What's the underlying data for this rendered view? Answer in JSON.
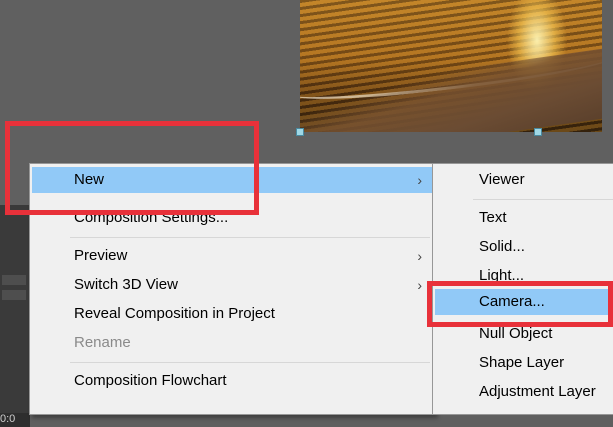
{
  "timeline": {
    "timecode": "0:0"
  },
  "context_menu": {
    "items": [
      {
        "label": "New",
        "arrow": "›",
        "highlight": true
      },
      {
        "label": "Composition Settings..."
      },
      {
        "label": "Preview",
        "arrow": "›"
      },
      {
        "label": "Switch 3D View",
        "arrow": "›"
      },
      {
        "label": "Reveal Composition in Project"
      },
      {
        "label": "Rename",
        "disabled": true
      },
      {
        "label": "Composition Flowchart"
      }
    ]
  },
  "submenu": {
    "items": [
      {
        "label": "Viewer"
      },
      {
        "label": "Text"
      },
      {
        "label": "Solid..."
      },
      {
        "label": "Light..."
      },
      {
        "label": "Camera...",
        "highlight": true
      },
      {
        "label": "Null Object"
      },
      {
        "label": "Shape Layer"
      },
      {
        "label": "Adjustment Layer"
      }
    ]
  },
  "colors": {
    "highlight": "#91c9f7",
    "annotation": "#e8313a",
    "menu_background": "#f0f0f0"
  }
}
